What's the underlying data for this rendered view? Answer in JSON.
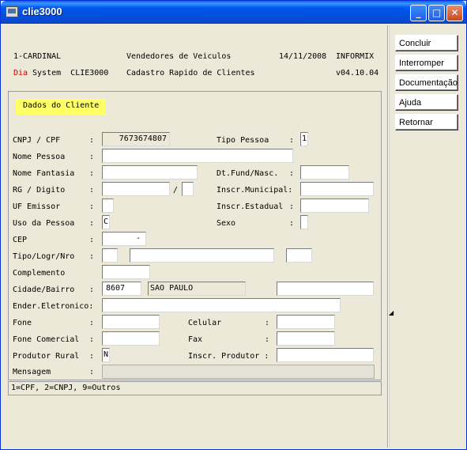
{
  "window": {
    "title": "clie3000"
  },
  "header": {
    "line1_left": "1-CARDINAL",
    "line1_center": "Vendedores de Veiculos",
    "line1_date": "14/11/2008",
    "line1_right": "INFORMIX",
    "line2_red": "Dia",
    "line2_left": " System  CLIE3000",
    "line2_center": "Cadastro Rapido de Clientes",
    "line2_right": "v04.10.04"
  },
  "panel": {
    "label": "Dados do Cliente"
  },
  "labels": {
    "cnpj": "CNPJ / CPF",
    "tipo_pessoa": "Tipo Pessoa",
    "nome_pessoa": "Nome Pessoa",
    "nome_fantasia": "Nome Fantasia",
    "dt_fund": "Dt.Fund/Nasc.",
    "rg": "RG / Digito",
    "rg_sep": "/",
    "inscr_municipal": "Inscr.Municipal:",
    "uf_emissor": "UF Emissor",
    "inscr_estadual": "Inscr.Estadual",
    "uso_pessoa": "Uso da Pessoa",
    "sexo": "Sexo",
    "cep": "CEP",
    "tipo_logr": "Tipo/Logr/Nro",
    "complemento": "Complemento",
    "cidade_bairro": "Cidade/Bairro",
    "ender_eletronico": "Ender.Eletronico:",
    "fone": "Fone",
    "celular": "Celular",
    "fone_comercial": "Fone Comercial",
    "fax": "Fax",
    "produtor_rural": "Produtor Rural",
    "inscr_produtor": "Inscr. Produtor :",
    "mensagem": "Mensagem",
    "colon": ":"
  },
  "values": {
    "cnpj": "7673674807",
    "tipo_pessoa": "1",
    "uso_pessoa": "C",
    "cep": "   -",
    "cidade_codigo": "8607",
    "cidade_nome": "SAO PAULO",
    "produtor_rural": "N"
  },
  "status": {
    "text": "1=CPF, 2=CNPJ, 9=Outros"
  },
  "buttons": {
    "concluir": "Concluir",
    "interromper": "Interromper",
    "documentacao": "Documentação",
    "ajuda": "Ajuda",
    "retornar": "Retornar"
  },
  "titlebar_buttons": {
    "minimize": "_",
    "maximize": "□",
    "close": "✕"
  },
  "icons": {
    "app": "app-window-icon",
    "resize": "resize-grip-icon"
  },
  "colors": {
    "title_blue": "#0058ee",
    "highlight_yellow": "#ffff66",
    "red_text": "#cc0000"
  }
}
